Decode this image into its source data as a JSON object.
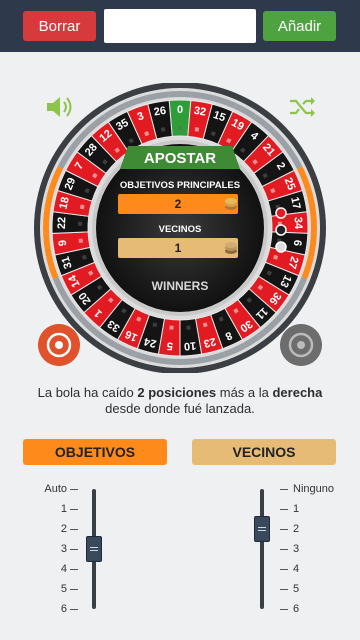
{
  "toolbar": {
    "clear_label": "Borrar",
    "search_value": "",
    "add_label": "Añadir"
  },
  "icons": {
    "sound": "speaker-icon",
    "shuffle": "shuffle-icon"
  },
  "wheel": {
    "title": "APOSTAR",
    "main_targets_label": "OBJETIVOS PRINCIPALES",
    "main_targets_value": "2",
    "neighbors_label": "VECINOS",
    "neighbors_value": "1",
    "brand": "WINNERS",
    "numbers": [
      "0",
      "32",
      "15",
      "19",
      "4",
      "21",
      "2",
      "25",
      "17",
      "34",
      "6",
      "27",
      "13",
      "36",
      "11",
      "30",
      "8",
      "23",
      "10",
      "5",
      "24",
      "16",
      "33",
      "1",
      "20",
      "14",
      "31",
      "9",
      "22",
      "18",
      "29",
      "7",
      "28",
      "12",
      "35",
      "3",
      "26"
    ],
    "colors": {
      "red": "#e21b23",
      "black": "#141414",
      "green": "#2f9e3a",
      "accent": "#ff8a1c"
    }
  },
  "message": {
    "part1": "La bola ha caído ",
    "bold1": "2 posiciones",
    "part2": " más a la ",
    "bold2": "derecha",
    "part3": " desde donde fué lanzada."
  },
  "tabs": {
    "targets": "OBJETIVOS",
    "neighbors": "VECINOS"
  },
  "sliders": {
    "targets": {
      "labels": [
        "Auto",
        "1",
        "2",
        "3",
        "4",
        "5",
        "6"
      ],
      "selected_index": 3
    },
    "neighbors": {
      "labels": [
        "Ninguno",
        "1",
        "2",
        "3",
        "4",
        "5",
        "6"
      ],
      "selected_index": 2
    }
  }
}
